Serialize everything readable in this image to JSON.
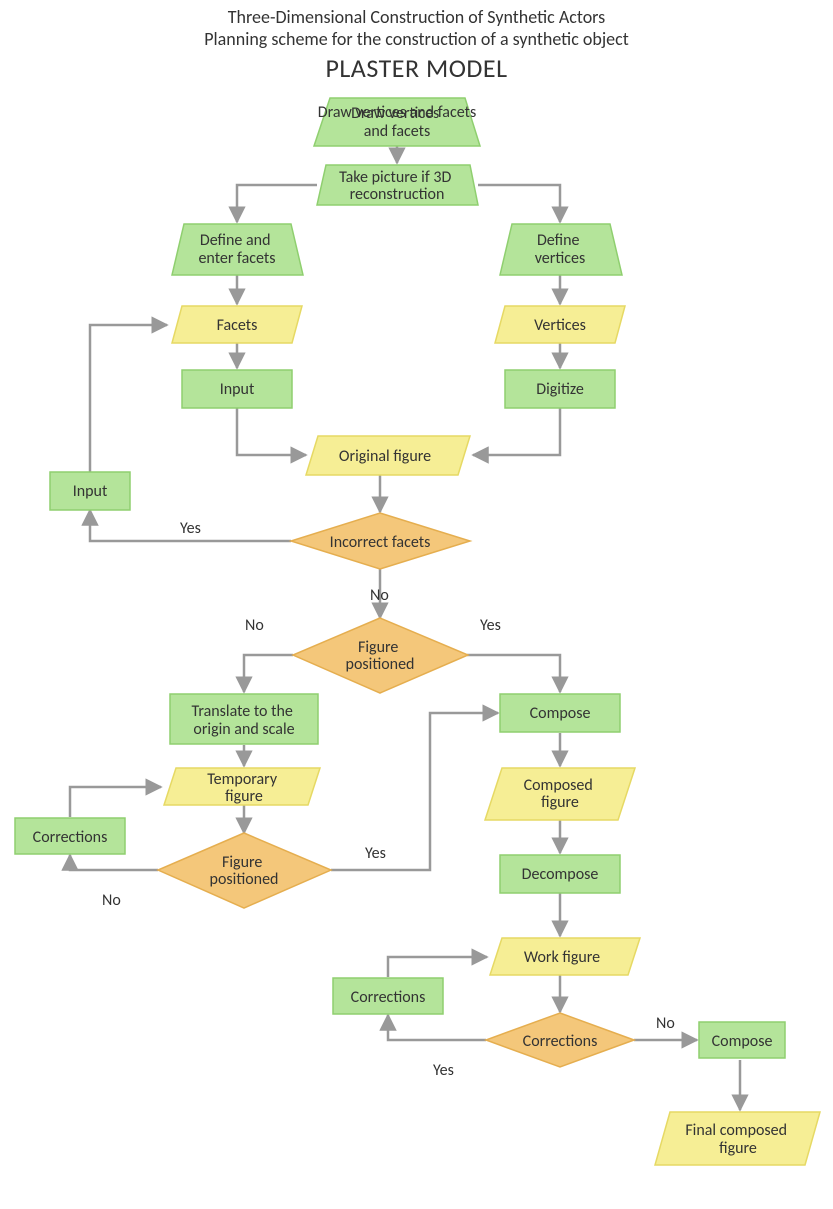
{
  "titles": {
    "line1": "Three-Dimensional Construction of Synthetic Actors",
    "line2": "Planning scheme for the construction of a synthetic object",
    "line3": "PLASTER MODEL"
  },
  "nodes": {
    "draw": "Draw vertices and facets",
    "take_picture": "Take picture if 3D reconstruction",
    "define_facets": "Define and enter facets",
    "define_vertices": "Define vertices",
    "facets": "Facets",
    "vertices": "Vertices",
    "input_proc": "Input",
    "digitize": "Digitize",
    "input_loop": "Input",
    "original_figure": "Original figure",
    "incorrect_facets": "Incorrect facets",
    "figure_positioned_1": "Figure positioned",
    "translate": "Translate to the origin and scale",
    "temp_figure": "Temporary figure",
    "figure_positioned_2": "Figure positioned",
    "corrections_left": "Corrections",
    "compose1": "Compose",
    "composed_figure": "Composed figure",
    "decompose": "Decompose",
    "work_figure": "Work figure",
    "corrections_bot": "Corrections",
    "corrections_d": "Corrections",
    "compose2": "Compose",
    "final_fig": "Final composed figure"
  },
  "labels": {
    "yes": "Yes",
    "no": "No"
  },
  "colors": {
    "green_fill": "#b4e49a",
    "green_stroke": "#8fcf6f",
    "yellow_fill": "#f6ee95",
    "yellow_stroke": "#e6d964",
    "orange_fill": "#f4c77a",
    "orange_stroke": "#e5ae4f",
    "arrow": "#999999"
  },
  "chart_data": {
    "type": "flowchart",
    "title": "Planning scheme for the construction of a synthetic object — PLASTER MODEL",
    "legend": {
      "green_trapezoid": "manual operation",
      "green_rectangle": "process",
      "yellow_parallelogram": "data / file",
      "orange_diamond": "decision"
    },
    "nodes": [
      {
        "id": "draw",
        "label": "Draw vertices and facets",
        "shape": "trapezoid",
        "color": "green"
      },
      {
        "id": "take_picture",
        "label": "Take picture if 3D reconstruction",
        "shape": "trapezoid",
        "color": "green"
      },
      {
        "id": "define_facets",
        "label": "Define and enter facets",
        "shape": "trapezoid",
        "color": "green"
      },
      {
        "id": "define_vertices",
        "label": "Define vertices",
        "shape": "trapezoid",
        "color": "green"
      },
      {
        "id": "facets",
        "label": "Facets",
        "shape": "parallelogram",
        "color": "yellow"
      },
      {
        "id": "vertices",
        "label": "Vertices",
        "shape": "parallelogram",
        "color": "yellow"
      },
      {
        "id": "input_proc",
        "label": "Input",
        "shape": "rectangle",
        "color": "green"
      },
      {
        "id": "digitize",
        "label": "Digitize",
        "shape": "rectangle",
        "color": "green"
      },
      {
        "id": "original_figure",
        "label": "Original figure",
        "shape": "parallelogram",
        "color": "yellow"
      },
      {
        "id": "incorrect_facets",
        "label": "Incorrect facets",
        "shape": "diamond",
        "color": "orange"
      },
      {
        "id": "input_loop",
        "label": "Input",
        "shape": "rectangle",
        "color": "green"
      },
      {
        "id": "figure_positioned_1",
        "label": "Figure positioned",
        "shape": "diamond",
        "color": "orange"
      },
      {
        "id": "translate",
        "label": "Translate to the origin and scale",
        "shape": "rectangle",
        "color": "green"
      },
      {
        "id": "temp_figure",
        "label": "Temporary figure",
        "shape": "parallelogram",
        "color": "yellow"
      },
      {
        "id": "figure_positioned_2",
        "label": "Figure positioned",
        "shape": "diamond",
        "color": "orange"
      },
      {
        "id": "corrections_left",
        "label": "Corrections",
        "shape": "rectangle",
        "color": "green"
      },
      {
        "id": "compose1",
        "label": "Compose",
        "shape": "rectangle",
        "color": "green"
      },
      {
        "id": "composed_figure",
        "label": "Composed figure",
        "shape": "parallelogram",
        "color": "yellow"
      },
      {
        "id": "decompose",
        "label": "Decompose",
        "shape": "rectangle",
        "color": "green"
      },
      {
        "id": "work_figure",
        "label": "Work figure",
        "shape": "parallelogram",
        "color": "yellow"
      },
      {
        "id": "corrections_bot",
        "label": "Corrections",
        "shape": "rectangle",
        "color": "green"
      },
      {
        "id": "corrections_d",
        "label": "Corrections",
        "shape": "diamond",
        "color": "orange"
      },
      {
        "id": "compose2",
        "label": "Compose",
        "shape": "rectangle",
        "color": "green"
      },
      {
        "id": "final_fig",
        "label": "Final composed figure",
        "shape": "parallelogram",
        "color": "yellow"
      }
    ],
    "edges": [
      {
        "from": "draw",
        "to": "take_picture"
      },
      {
        "from": "take_picture",
        "to": "define_facets"
      },
      {
        "from": "take_picture",
        "to": "define_vertices"
      },
      {
        "from": "define_facets",
        "to": "facets"
      },
      {
        "from": "define_vertices",
        "to": "vertices"
      },
      {
        "from": "facets",
        "to": "input_proc"
      },
      {
        "from": "vertices",
        "to": "digitize"
      },
      {
        "from": "input_proc",
        "to": "original_figure"
      },
      {
        "from": "digitize",
        "to": "original_figure"
      },
      {
        "from": "original_figure",
        "to": "incorrect_facets"
      },
      {
        "from": "incorrect_facets",
        "to": "input_loop",
        "label": "Yes"
      },
      {
        "from": "input_loop",
        "to": "facets"
      },
      {
        "from": "incorrect_facets",
        "to": "figure_positioned_1",
        "label": "No"
      },
      {
        "from": "figure_positioned_1",
        "to": "translate",
        "label": "No"
      },
      {
        "from": "figure_positioned_1",
        "to": "compose1",
        "label": "Yes"
      },
      {
        "from": "translate",
        "to": "temp_figure"
      },
      {
        "from": "temp_figure",
        "to": "figure_positioned_2"
      },
      {
        "from": "figure_positioned_2",
        "to": "corrections_left",
        "label": "No"
      },
      {
        "from": "corrections_left",
        "to": "temp_figure"
      },
      {
        "from": "figure_positioned_2",
        "to": "compose1",
        "label": "Yes"
      },
      {
        "from": "compose1",
        "to": "composed_figure"
      },
      {
        "from": "composed_figure",
        "to": "decompose"
      },
      {
        "from": "decompose",
        "to": "work_figure"
      },
      {
        "from": "work_figure",
        "to": "corrections_d"
      },
      {
        "from": "corrections_d",
        "to": "corrections_bot",
        "label": "Yes"
      },
      {
        "from": "corrections_bot",
        "to": "work_figure"
      },
      {
        "from": "corrections_d",
        "to": "compose2",
        "label": "No"
      },
      {
        "from": "compose2",
        "to": "final_fig"
      }
    ]
  }
}
